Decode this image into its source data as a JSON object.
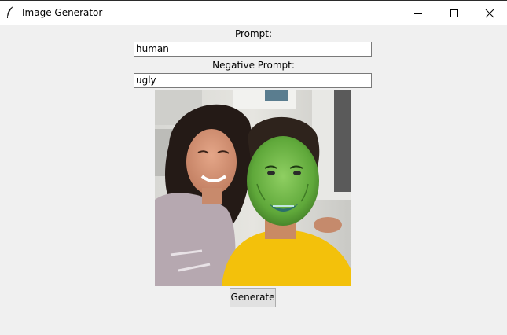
{
  "window": {
    "title": "Image Generator",
    "icon": "feather-icon"
  },
  "controls": {
    "minimize_icon": "minimize-icon",
    "maximize_icon": "maximize-icon",
    "close_icon": "close-icon"
  },
  "form": {
    "prompt_label": "Prompt:",
    "prompt_value": "human",
    "negative_label": "Negative Prompt:",
    "negative_value": "ugly",
    "generate_label": "Generate"
  },
  "image": {
    "description_icon": "generated-image"
  }
}
